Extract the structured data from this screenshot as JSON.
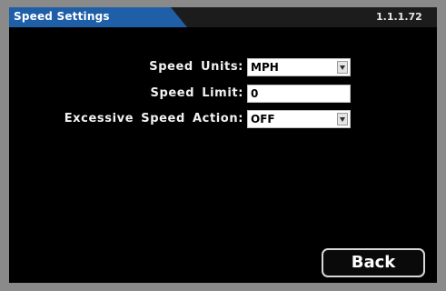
{
  "title_bar": {
    "title": "Speed Settings",
    "version": "1.1.1.72"
  },
  "form": {
    "speed_units": {
      "label": "Speed Units:",
      "value": "MPH"
    },
    "speed_limit": {
      "label": "Speed Limit:",
      "value": "0"
    },
    "excessive_speed_action": {
      "label": "Excessive Speed Action:",
      "value": "OFF"
    }
  },
  "actions": {
    "back_label": "Back"
  },
  "icons": {
    "dropdown": "chevron-down-icon"
  },
  "colors": {
    "title_tab": "#1f5fa8",
    "screen_background": "#000000",
    "bezel": "#8a8a8a"
  }
}
